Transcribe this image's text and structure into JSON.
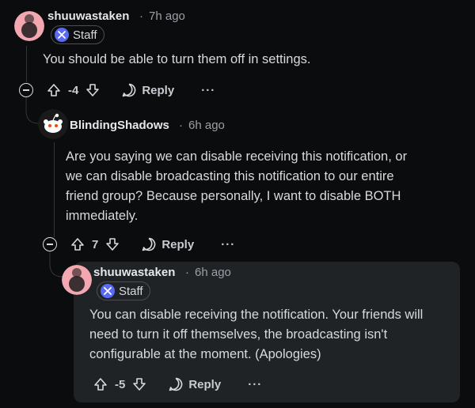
{
  "comments": [
    {
      "username": "shuuwastaken",
      "sep": "·",
      "time": "7h ago",
      "badge": "Staff",
      "body": "You should be able to turn them off in settings.",
      "score": "-4",
      "reply": "Reply",
      "more": "···"
    },
    {
      "username": "BlindingShadows",
      "sep": "·",
      "time": "6h ago",
      "body_lines": [
        "Are you saying we can disable receiving this notification, or",
        "we can disable broadcasting this notification to our entire",
        "friend group? Because personally, I want to disable BOTH",
        "immediately."
      ],
      "score": "7",
      "reply": "Reply",
      "more": "···"
    },
    {
      "username": "shuuwastaken",
      "sep": "·",
      "time": "6h ago",
      "badge": "Staff",
      "body_lines": [
        "You can disable receiving the notification. Your friends will",
        "need to turn it off themselves, the broadcasting isn't",
        "configurable at the moment. (Apologies)"
      ],
      "score": "-5",
      "reply": "Reply",
      "more": "···"
    }
  ],
  "colors": {
    "background": "#0b0c0e",
    "highlight": "#1f2326",
    "staff_badge": "#5a6af5",
    "avatar_pink": "#f3a7b0"
  }
}
